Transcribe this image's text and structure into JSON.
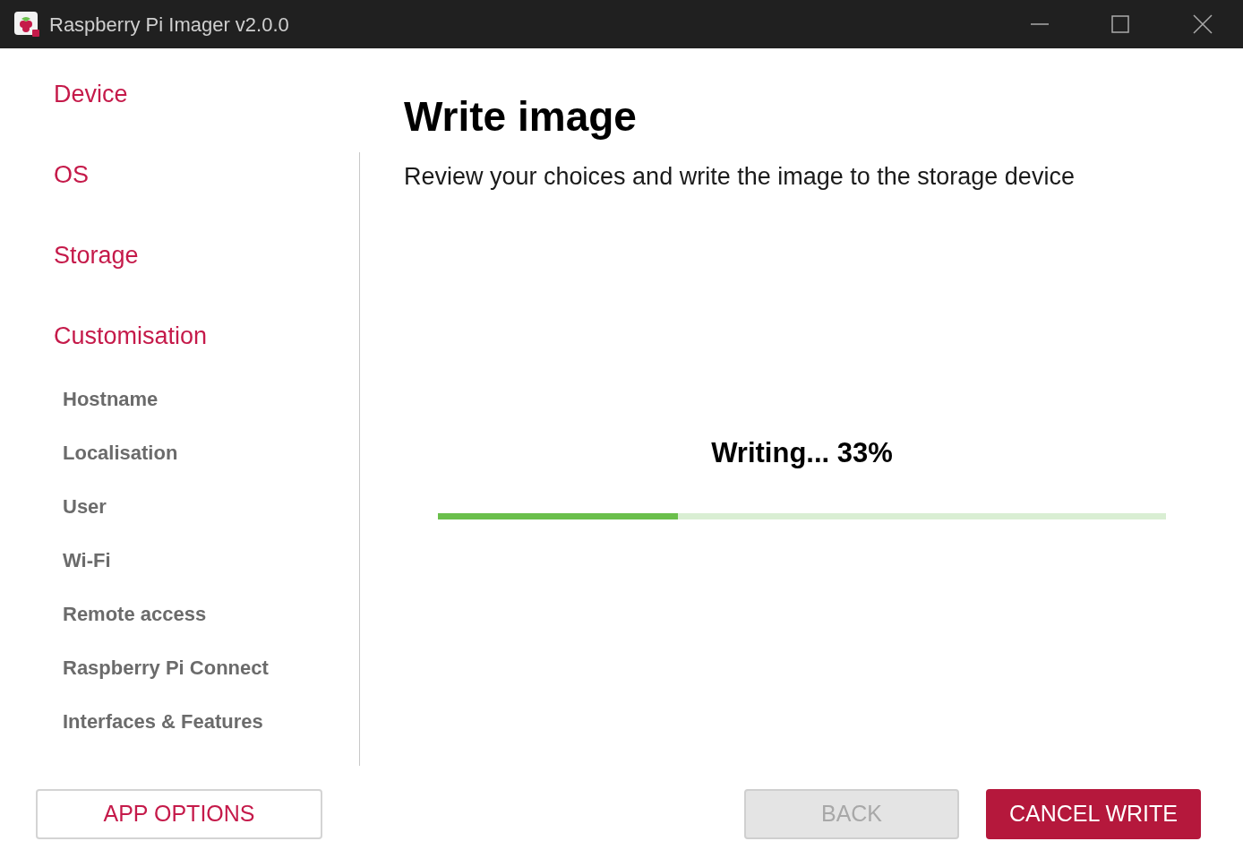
{
  "window": {
    "title": "Raspberry Pi Imager v2.0.0"
  },
  "sidebar": {
    "items": [
      {
        "label": "Device"
      },
      {
        "label": "OS"
      },
      {
        "label": "Storage"
      },
      {
        "label": "Customisation",
        "children": [
          {
            "label": "Hostname"
          },
          {
            "label": "Localisation"
          },
          {
            "label": "User"
          },
          {
            "label": "Wi-Fi"
          },
          {
            "label": "Remote access"
          },
          {
            "label": "Raspberry Pi Connect"
          },
          {
            "label": "Interfaces & Features"
          }
        ]
      }
    ]
  },
  "main": {
    "title": "Write image",
    "subtitle": "Review your choices and write the image to the storage device",
    "progress": {
      "status": "Writing... 33%",
      "level": 0.33
    }
  },
  "buttons": [
    {
      "label": "APP OPTIONS",
      "kind": "outline",
      "disabled": false
    },
    {
      "label": "BACK",
      "kind": "secondary",
      "disabled": true
    },
    {
      "label": "CANCEL WRITE",
      "kind": "primary",
      "disabled": false
    }
  ]
}
